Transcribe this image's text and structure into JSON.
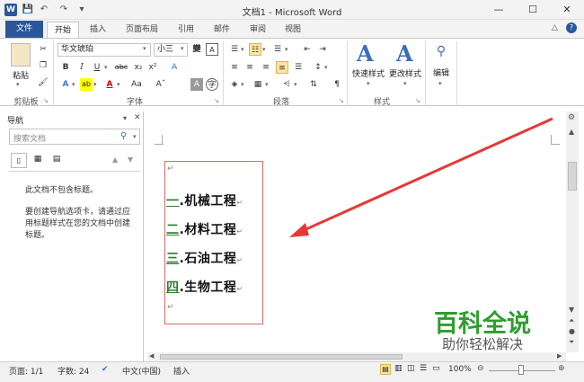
{
  "window": {
    "title": "文档1 - Microsoft Word",
    "app_icon": "W"
  },
  "quick_access": {
    "save": "💾",
    "undo": "↶",
    "redo": "↷",
    "customize": "▾"
  },
  "tabs": [
    {
      "label": "文件"
    },
    {
      "label": "开始"
    },
    {
      "label": "插入"
    },
    {
      "label": "页面布局"
    },
    {
      "label": "引用"
    },
    {
      "label": "邮件"
    },
    {
      "label": "审阅"
    },
    {
      "label": "视图"
    }
  ],
  "ribbon": {
    "clipboard": {
      "paste_label": "粘贴",
      "group_label": "剪贴板"
    },
    "font": {
      "font_name": "华文琥珀",
      "font_size": "小三",
      "group_label": "字体"
    },
    "paragraph": {
      "group_label": "段落"
    },
    "styles": {
      "quick_styles_label": "快速样式",
      "change_styles_label": "更改样式",
      "group_label": "样式"
    },
    "editing": {
      "label": "编辑"
    }
  },
  "nav": {
    "title": "导航",
    "search_placeholder": "搜索文档",
    "empty_line1": "此文档不包含标题。",
    "empty_line2": "要创建导航选项卡，请通过应用标题样式在您的文档中创建标题。"
  },
  "document": {
    "headings": [
      {
        "number": "一",
        "text": "机械工程"
      },
      {
        "number": "二",
        "text": "材料工程"
      },
      {
        "number": "三",
        "text": "石油工程"
      },
      {
        "number": "四",
        "text": "生物工程"
      }
    ]
  },
  "status": {
    "page": "页面: 1/1",
    "words": "字数: 24",
    "language": "中文(中国)",
    "mode": "插入",
    "zoom": "100%"
  },
  "watermark": {
    "line1": "百科全说",
    "line2": "助你轻松解决"
  }
}
